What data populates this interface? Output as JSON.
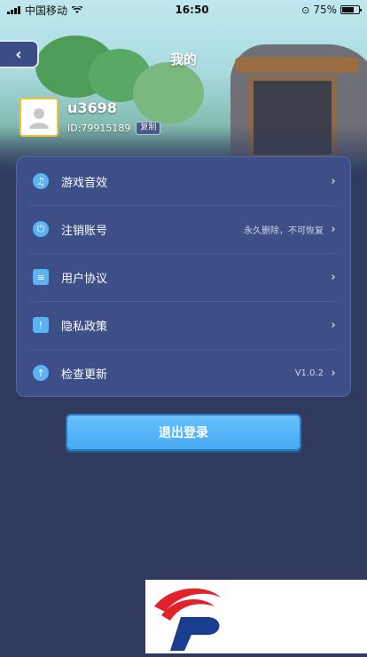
{
  "status_bar": {
    "carrier": "中国移动",
    "time": "16:50",
    "battery": "75%",
    "battery_level": 0.75
  },
  "header": {
    "back_label": "‹",
    "title": "我的"
  },
  "profile": {
    "username": "u3698",
    "id_text": "ID:79915189",
    "copy_label": "复制"
  },
  "settings": [
    {
      "icon": "music-note-icon",
      "glyph": "♫",
      "label": "游戏音效",
      "value": "",
      "chevron": "›"
    },
    {
      "icon": "power-icon",
      "glyph": "⏻",
      "label": "注销账号",
      "value": "永久删除，不可恢复",
      "chevron": "›"
    },
    {
      "icon": "document-icon",
      "glyph": "≡",
      "label": "用户协议",
      "value": "",
      "chevron": "›"
    },
    {
      "icon": "shield-icon",
      "glyph": "!",
      "label": "隐私政策",
      "value": "",
      "chevron": "›"
    },
    {
      "icon": "upload-arrow-icon",
      "glyph": "↑",
      "label": "检查更新",
      "value": "V1.0.2",
      "chevron": "›"
    }
  ],
  "logout_label": "退出登录",
  "colors": {
    "accent": "#5bb2f5",
    "panel": "#3d4f86",
    "background": "#2f3a5e",
    "avatar_border": "#f0c23a"
  }
}
